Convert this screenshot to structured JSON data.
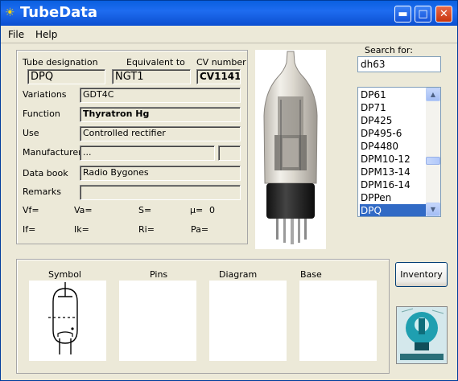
{
  "window": {
    "title": "TubeData",
    "controls": [
      "minimize",
      "maximize",
      "close"
    ],
    "colors": {
      "titlebar": "#0a5fe0",
      "close_button": "#c8340c",
      "selection": "#316ac5"
    }
  },
  "menu": {
    "file": "File",
    "help": "Help"
  },
  "details": {
    "headers": {
      "designation": "Tube designation",
      "equivalent": "Equivalent to",
      "cv": "CV number"
    },
    "designation": "DPQ",
    "equivalent": "NGT1",
    "cv_number": "CV1141",
    "labels": {
      "variations": "Variations",
      "function": "Function",
      "use": "Use",
      "manufacturer": "Manufacturer",
      "databook": "Data book",
      "remarks": "Remarks"
    },
    "variations": "GDT4C",
    "function": "Thyratron Hg",
    "use": "Controlled rectifier",
    "manufacturer": "...",
    "databook": "Radio Bygones",
    "remarks": ""
  },
  "params": {
    "vf": "Vf=",
    "va": "Va=",
    "s": "S=",
    "mu": "µ=",
    "mu_value": "0",
    "if": "If=",
    "ik": "Ik=",
    "ri": "Ri=",
    "pa": "Pa="
  },
  "search": {
    "label": "Search for:",
    "value": "dh63"
  },
  "tube_list": {
    "items": [
      "DP61",
      "DP71",
      "DP425",
      "DP495-6",
      "DP4480",
      "DPM10-12",
      "DPM13-14",
      "DPM16-14",
      "DPPen",
      "DPQ"
    ],
    "selected": "DPQ"
  },
  "panels": {
    "symbol": "Symbol",
    "pins": "Pins",
    "diagram": "Diagram",
    "base": "Base"
  },
  "inventory_button": "Inventory",
  "icons": {
    "app": "bulb-icon",
    "minimize": "minimize-icon",
    "maximize": "maximize-icon",
    "close": "close-icon",
    "scroll_up": "chevron-up-icon",
    "scroll_down": "chevron-down-icon"
  }
}
